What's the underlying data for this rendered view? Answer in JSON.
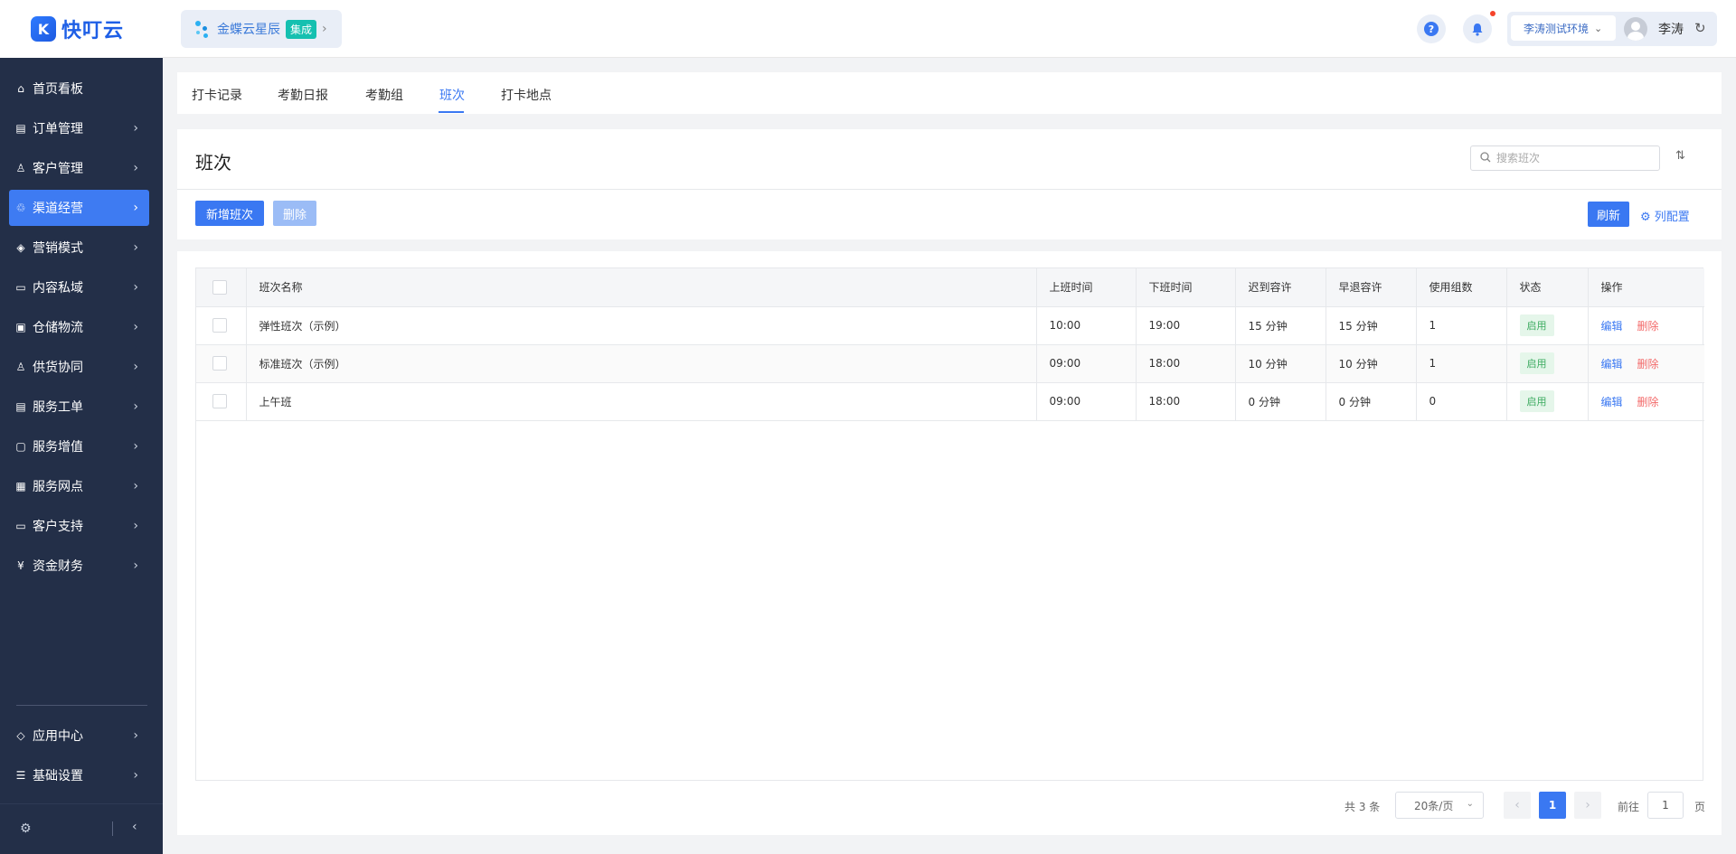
{
  "brand": {
    "logo_glyph": "K",
    "name": "快叮云"
  },
  "org": {
    "name": "金蝶云星辰",
    "badge": "集成",
    "arrow": "›"
  },
  "header": {
    "help_glyph": "?",
    "bell_glyph": "🔔",
    "env_label": "李涛测试环境",
    "env_chevron": "⌄",
    "user_name": "李涛",
    "refresh_glyph": "↻"
  },
  "sidebar": {
    "items": [
      {
        "label": "首页看板",
        "icon": "⌂",
        "has_arrow": false
      },
      {
        "label": "订单管理",
        "icon": "▤"
      },
      {
        "label": "客户管理",
        "icon": "♙"
      },
      {
        "label": "渠道经营",
        "icon": "♲"
      },
      {
        "label": "营销模式",
        "icon": "◈"
      },
      {
        "label": "内容私域",
        "icon": "▭"
      },
      {
        "label": "仓储物流",
        "icon": "▣"
      },
      {
        "label": "供货协同",
        "icon": "♙"
      },
      {
        "label": "服务工单",
        "icon": "▤"
      },
      {
        "label": "服务增值",
        "icon": "▢"
      },
      {
        "label": "服务网点",
        "icon": "▦"
      },
      {
        "label": "客户支持",
        "icon": "▭"
      },
      {
        "label": "资金财务",
        "icon": "¥"
      },
      {
        "label": "应用中心",
        "icon": "◇"
      },
      {
        "label": "基础设置",
        "icon": "☰"
      }
    ],
    "chevron": "›",
    "gear_glyph": "⚙",
    "collapse_glyph": "‹"
  },
  "tabs": [
    {
      "label": "打卡记录"
    },
    {
      "label": "考勤日报"
    },
    {
      "label": "考勤组"
    },
    {
      "label": "班次"
    },
    {
      "label": "打卡地点"
    }
  ],
  "page": {
    "title": "班次",
    "search_placeholder": "搜索班次",
    "search_glyph": "○",
    "sort_glyph": "⇅",
    "add_button": "新增班次",
    "delete_button": "删除",
    "refresh_button": "刷新",
    "column_config": "⚙ 列配置"
  },
  "table": {
    "headers": [
      "班次名称",
      "上班时间",
      "下班时间",
      "迟到容许",
      "早退容许",
      "使用组数",
      "状态",
      "操作"
    ],
    "rows": [
      {
        "name": "弹性班次（示例）",
        "start": "10:00",
        "end": "19:00",
        "late": "15 分钟",
        "early": "15 分钟",
        "groups": "1",
        "status": "启用"
      },
      {
        "name": "标准班次（示例）",
        "start": "09:00",
        "end": "18:00",
        "late": "10 分钟",
        "early": "10 分钟",
        "groups": "1",
        "status": "启用"
      },
      {
        "name": "上午班",
        "start": "09:00",
        "end": "18:00",
        "late": "0 分钟",
        "early": "0 分钟",
        "groups": "0",
        "status": "启用"
      }
    ],
    "edit_label": "编辑",
    "delete_label": "删除"
  },
  "pagination": {
    "total": "共 3 条",
    "page_size": "20条/页",
    "size_chevron": "⌄",
    "prev": "‹",
    "current": "1",
    "next": "›",
    "goto_label": "前往",
    "goto_value": "1",
    "page_suffix": "页"
  },
  "colors": {
    "accent": "#3a78f2",
    "sidebar_bg": "#232f48",
    "status_green": "#3cab60",
    "danger": "#f36a6a"
  }
}
